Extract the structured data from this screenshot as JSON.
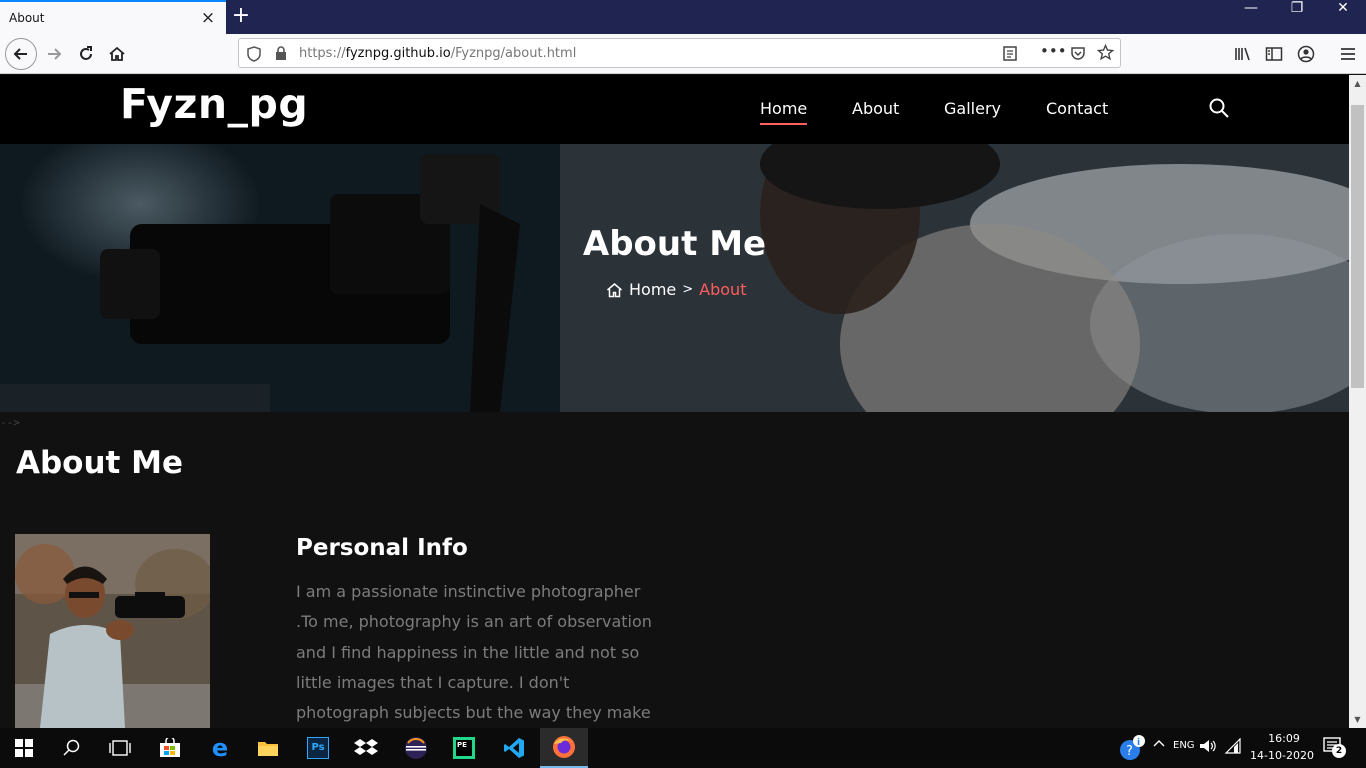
{
  "browser": {
    "tab_title": "About",
    "tab_close": "×",
    "new_tab": "+",
    "url_prefix": "https://",
    "url_host": "fyznpg.github.io",
    "url_path": "/Fyznpg/about.html",
    "window_controls": {
      "minimize": "—",
      "restore": "❐",
      "close": "✕"
    }
  },
  "site": {
    "logo": "Fyzn_pg",
    "menu": [
      {
        "label": "Home",
        "active": true
      },
      {
        "label": "About",
        "active": false
      },
      {
        "label": "Gallery",
        "active": false
      },
      {
        "label": "Contact",
        "active": false
      }
    ]
  },
  "hero": {
    "title": "About Me",
    "breadcrumb_home": "Home",
    "breadcrumb_separator": ">",
    "breadcrumb_current": "About"
  },
  "page": {
    "comment_artifact": "-->",
    "section_title": "About Me",
    "info_title": "Personal Info",
    "info_text": "I am a passionate instinctive photographer .To me, photography is an art of observation and I find happiness in the little and not so little images that I capture. I don't photograph subjects but the way they make"
  },
  "taskbar": {
    "time": "16:09",
    "date": "14-10-2020",
    "notification_count": "2",
    "language_indicator": "ENG"
  },
  "colors": {
    "accent": "#ff5e5e",
    "header_bg": "#000000",
    "page_bg": "#111111",
    "tab_accent": "#0a84ff"
  }
}
